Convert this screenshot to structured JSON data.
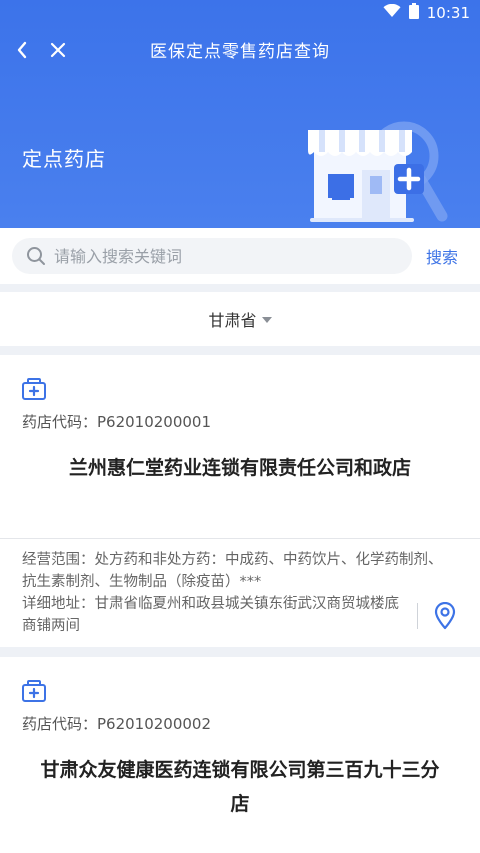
{
  "status": {
    "time": "10:31",
    "wifi_icon": "wifi-icon",
    "battery_icon": "battery-icon"
  },
  "nav": {
    "title": "医保定点零售药店查询",
    "back_icon": "back-icon",
    "close_icon": "close-icon"
  },
  "banner": {
    "title": "定点药店"
  },
  "search": {
    "placeholder": "请输入搜索关键词",
    "value": "",
    "button_label": "搜索"
  },
  "filter": {
    "province": "甘肃省"
  },
  "pharmacies": [
    {
      "code_label": "药店代码：P62010200001",
      "name": "兰州惠仁堂药业连锁有限责任公司和政店",
      "scope_label": "经营范围：处方药和非处方药：中成药、中药饮片、化学药制剂、抗生素制剂、生物制品（除疫苗）***",
      "address_label": "详细地址：甘肃省临夏州和政县城关镇东街武汉商贸城楼底商铺两间"
    },
    {
      "code_label": "药店代码：P62010200002",
      "name": "甘肃众友健康医药连锁有限公司第三百九十三分店"
    }
  ],
  "colors": {
    "primary": "#3d73e6",
    "header_bg": "#4179ec",
    "page_bg": "#eef1f6"
  }
}
